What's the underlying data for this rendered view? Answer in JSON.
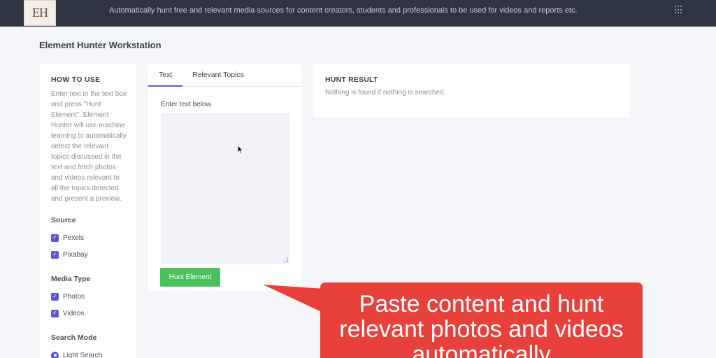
{
  "app": {
    "logo_text": "EH",
    "tagline": "Automatically hunt free and relevant media sources for content creators, students and professionals to be used for videos and reports etc."
  },
  "page": {
    "title": "Element Hunter Workstation"
  },
  "how_to_use": {
    "heading": "HOW TO USE",
    "text": "Enter text in the text box and press \"Hunt Element\". Element Hunter will use machine learning to automatically detect the relevant topics discussed in the text and fetch photos and videos relevant to all the topics detected and present a preview."
  },
  "source": {
    "label": "Source",
    "options": [
      {
        "label": "Pexels",
        "checked": true
      },
      {
        "label": "Pixabay",
        "checked": true
      }
    ]
  },
  "media_type": {
    "label": "Media Type",
    "options": [
      {
        "label": "Photos",
        "checked": true
      },
      {
        "label": "Videos",
        "checked": true
      }
    ]
  },
  "search_mode": {
    "label": "Search Mode",
    "options": [
      {
        "label": "Light Search",
        "selected": true
      }
    ]
  },
  "input_panel": {
    "tabs": [
      {
        "label": "Text",
        "active": true
      },
      {
        "label": "Relevant Topics",
        "active": false
      }
    ],
    "field_label": "Enter text below",
    "textarea_value": "",
    "button_label": "Hunt Element"
  },
  "result_panel": {
    "heading": "HUNT RESULT",
    "empty_message": "Nothing is found if nothing is searched."
  },
  "callout": {
    "text": "Paste content and hunt relevant photos and videos automatically"
  },
  "colors": {
    "topbar": "#2f3442",
    "accent": "#5b57d1",
    "button_green": "#4cbf5e",
    "callout_red": "#e8403a"
  },
  "icons": {
    "apps_menu": "grid-icon",
    "checkbox": "check-icon",
    "radio": "radio-icon"
  }
}
